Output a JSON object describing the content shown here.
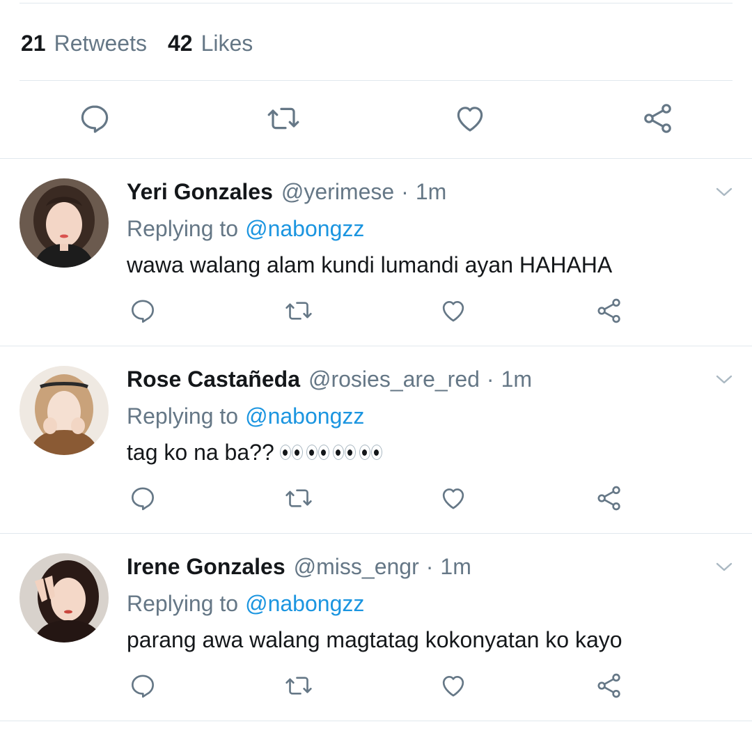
{
  "stats": {
    "retweets_count": "21",
    "retweets_label": "Retweets",
    "likes_count": "42",
    "likes_label": "Likes"
  },
  "icons": {
    "reply": "reply-icon",
    "retweet": "retweet-icon",
    "like": "heart-icon",
    "share": "share-icon",
    "more": "chevron-down-icon"
  },
  "colors": {
    "text_primary": "#14171a",
    "text_secondary": "#657786",
    "link": "#1b95e0",
    "icon": "#657786",
    "divider": "#e1e8ed"
  },
  "replies": [
    {
      "name": "Yeri Gonzales",
      "handle": "@yerimese",
      "separator": "·",
      "time": "1m",
      "replying_label": "Replying to",
      "replying_to": "@nabongzz",
      "text": "wawa walang alam kundi lumandi ayan HAHAHA"
    },
    {
      "name": "Rose Castañeda",
      "handle": "@rosies_are_red",
      "separator": "·",
      "time": "1m",
      "replying_label": "Replying to",
      "replying_to": "@nabongzz",
      "text": "tag ko na ba??",
      "emoji": "👀👀👀👀"
    },
    {
      "name": "Irene Gonzales",
      "handle": "@miss_engr",
      "separator": "·",
      "time": "1m",
      "replying_label": "Replying to",
      "replying_to": "@nabongzz",
      "text": "parang awa walang magtatag kokonyatan ko kayo"
    }
  ]
}
